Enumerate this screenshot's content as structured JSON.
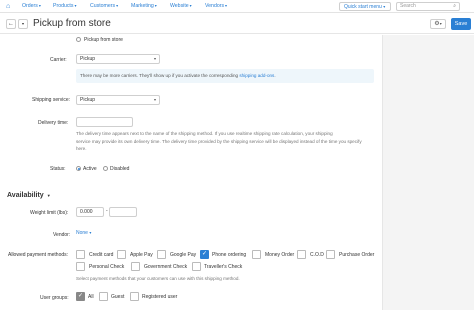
{
  "topnav": {
    "items": [
      {
        "label": "Orders"
      },
      {
        "label": "Products"
      },
      {
        "label": "Customers"
      },
      {
        "label": "Marketing"
      },
      {
        "label": "Website"
      },
      {
        "label": "Vendors"
      }
    ],
    "quick_start": "Quick start menu",
    "search_placeholder": "Search"
  },
  "header": {
    "title": "Pickup from store",
    "save_label": "Save"
  },
  "form": {
    "pickup_radio": "Pickup from store",
    "carrier_label": "Carrier:",
    "carrier_value": "Pickup",
    "notice_text": "There may be more carriers. They'll show up if you activate the corresponding",
    "notice_link": "shipping add-ons",
    "notice_end": ".",
    "shipping_service_label": "Shipping service:",
    "shipping_service_value": "Pickup",
    "delivery_time_label": "Delivery time:",
    "delivery_time_value": "",
    "delivery_help_1": "The delivery time appears next to the name of the shipping method. If you use realtime shipping rate calculation, your shipping",
    "delivery_help_2": "service may provide its own delivery time. The delivery time provided by the shipping service will be displayed instead of the time you specify",
    "delivery_help_3": "here.",
    "status_label": "Status:",
    "status_options": [
      {
        "label": "Active",
        "selected": true
      },
      {
        "label": "Disabled",
        "selected": false
      }
    ]
  },
  "availability": {
    "title": "Availability",
    "weight_label": "Weight limit (lbs):",
    "weight_min": "0.000",
    "weight_sep": "-",
    "weight_max": "",
    "vendor_label": "Vendor:",
    "vendor_value": "None",
    "payment_label": "Allowed payment methods:",
    "payment_methods": [
      {
        "label": "Credit card",
        "checked": false
      },
      {
        "label": "Apple Pay",
        "checked": false
      },
      {
        "label": "Google Pay",
        "checked": false
      },
      {
        "label": "Phone ordering",
        "checked": true
      },
      {
        "label": "Money Order",
        "checked": false
      },
      {
        "label": "C.O.D",
        "checked": false
      },
      {
        "label": "Purchase Order",
        "checked": false
      },
      {
        "label": "Personal Check",
        "checked": false
      },
      {
        "label": "Government Check",
        "checked": false
      },
      {
        "label": "Traveller's Check",
        "checked": false
      }
    ],
    "payment_help": "Select payment methods that your customers can use with this shipping method.",
    "user_groups_label": "User groups:",
    "user_groups": [
      {
        "label": "All",
        "checked": true
      },
      {
        "label": "Guest",
        "checked": false
      },
      {
        "label": "Registered user",
        "checked": false
      }
    ]
  },
  "colors": {
    "accent": "#2a7fd4",
    "sidebar_bg": "#f4f4f4"
  }
}
